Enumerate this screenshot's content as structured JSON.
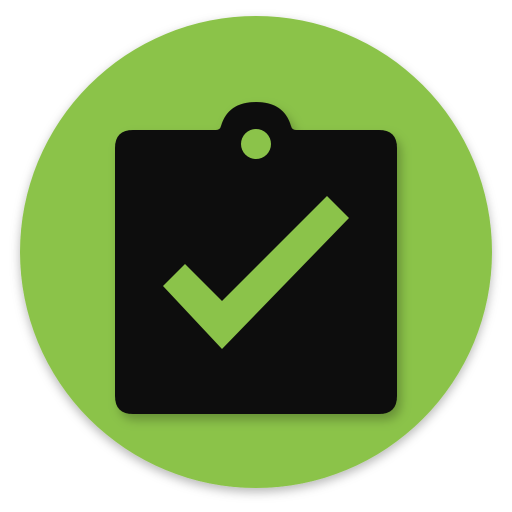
{
  "app_icon": {
    "icon_name": "clipboard-check-icon",
    "colors": {
      "background_circle": "#8bc34a",
      "clipboard": "#0b0b0b",
      "checkmark": "#8bc34a",
      "shadow": "#000000"
    }
  }
}
